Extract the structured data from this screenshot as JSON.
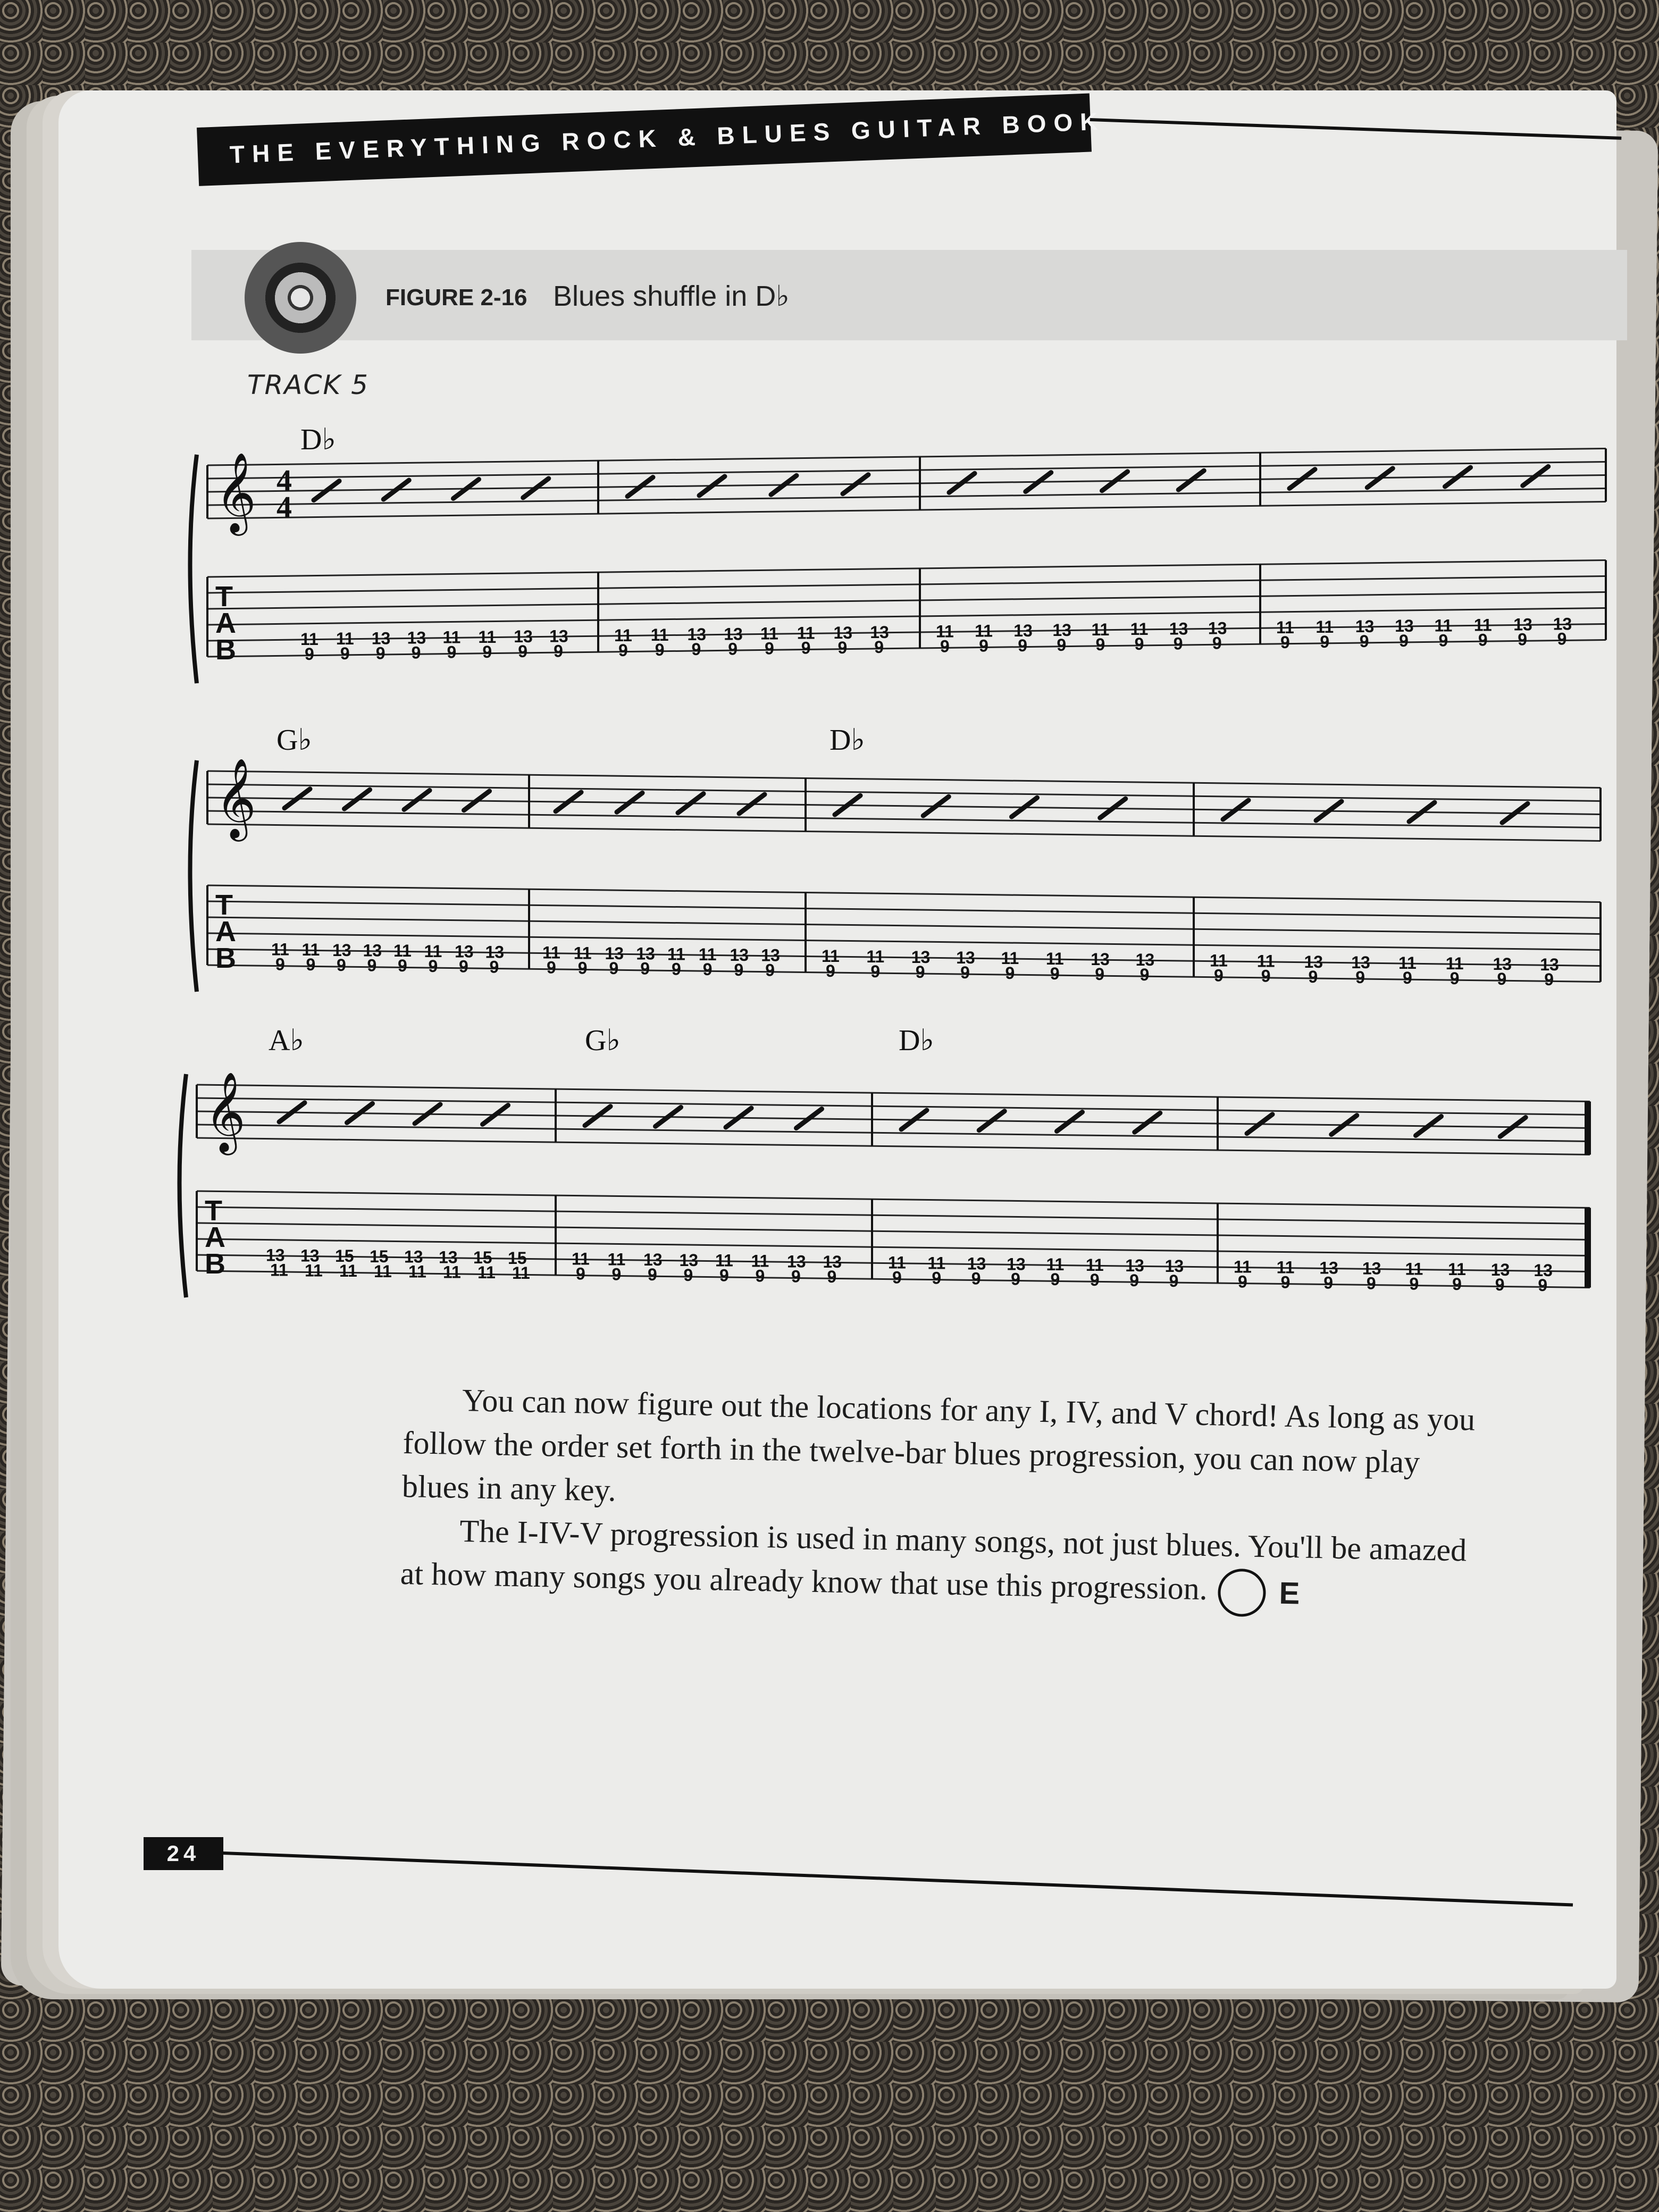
{
  "header": {
    "title": "THE EVERYTHING ROCK & BLUES GUITAR BOOK"
  },
  "figure": {
    "label": "FIGURE 2-16",
    "caption": "Blues shuffle in D♭",
    "track": "TRACK 5",
    "icon": "cd-icon"
  },
  "score": {
    "time_signature": "4/4",
    "clef": "treble",
    "tab_letters": [
      "T",
      "A",
      "B"
    ],
    "systems": [
      {
        "chords": [
          "D♭",
          "",
          "",
          ""
        ],
        "measures": [
          {
            "top": [
              "11",
              "11",
              "13",
              "13",
              "11",
              "11",
              "13",
              "13"
            ],
            "bottom": [
              "9",
              "9",
              "9",
              "9",
              "9",
              "9",
              "9",
              "9"
            ]
          },
          {
            "top": [
              "11",
              "11",
              "13",
              "13",
              "11",
              "11",
              "13",
              "13"
            ],
            "bottom": [
              "9",
              "9",
              "9",
              "9",
              "9",
              "9",
              "9",
              "9"
            ]
          },
          {
            "top": [
              "11",
              "11",
              "13",
              "13",
              "11",
              "11",
              "13",
              "13"
            ],
            "bottom": [
              "9",
              "9",
              "9",
              "9",
              "9",
              "9",
              "9",
              "9"
            ]
          },
          {
            "top": [
              "11",
              "11",
              "13",
              "13",
              "11",
              "11",
              "13",
              "13"
            ],
            "bottom": [
              "9",
              "9",
              "9",
              "9",
              "9",
              "9",
              "9",
              "9"
            ]
          }
        ]
      },
      {
        "chords": [
          "G♭",
          "",
          "D♭",
          ""
        ],
        "measures": [
          {
            "top": [
              "11",
              "11",
              "13",
              "13",
              "11",
              "11",
              "13",
              "13"
            ],
            "bottom": [
              "9",
              "9",
              "9",
              "9",
              "9",
              "9",
              "9",
              "9"
            ]
          },
          {
            "top": [
              "11",
              "11",
              "13",
              "13",
              "11",
              "11",
              "13",
              "13"
            ],
            "bottom": [
              "9",
              "9",
              "9",
              "9",
              "9",
              "9",
              "9",
              "9"
            ]
          },
          {
            "top": [
              "11",
              "11",
              "13",
              "13",
              "11",
              "11",
              "13",
              "13"
            ],
            "bottom": [
              "9",
              "9",
              "9",
              "9",
              "9",
              "9",
              "9",
              "9"
            ]
          },
          {
            "top": [
              "11",
              "11",
              "13",
              "13",
              "11",
              "11",
              "13",
              "13"
            ],
            "bottom": [
              "9",
              "9",
              "9",
              "9",
              "9",
              "9",
              "9",
              "9"
            ]
          }
        ]
      },
      {
        "chords": [
          "A♭",
          "G♭",
          "D♭",
          ""
        ],
        "measures": [
          {
            "top": [
              "13",
              "13",
              "15",
              "15",
              "13",
              "13",
              "15",
              "15"
            ],
            "bottom": [
              "11",
              "11",
              "11",
              "11",
              "11",
              "11",
              "11",
              "11"
            ]
          },
          {
            "top": [
              "11",
              "11",
              "13",
              "13",
              "11",
              "11",
              "13",
              "13"
            ],
            "bottom": [
              "9",
              "9",
              "9",
              "9",
              "9",
              "9",
              "9",
              "9"
            ]
          },
          {
            "top": [
              "11",
              "11",
              "13",
              "13",
              "11",
              "11",
              "13",
              "13"
            ],
            "bottom": [
              "9",
              "9",
              "9",
              "9",
              "9",
              "9",
              "9",
              "9"
            ]
          },
          {
            "top": [
              "11",
              "11",
              "13",
              "13",
              "11",
              "11",
              "13",
              "13"
            ],
            "bottom": [
              "9",
              "9",
              "9",
              "9",
              "9",
              "9",
              "9",
              "9"
            ]
          }
        ]
      }
    ]
  },
  "body": {
    "paragraph1": "You can now figure out the locations for any I, IV, and V chord! As long as you follow the order set forth in the twelve-bar blues progression, you can now play blues in any key.",
    "paragraph2": "The I-IV-V progression is used in many songs, not just blues. You'll be amazed at how many songs you already know that use this progression.",
    "end_marker": "E"
  },
  "footer": {
    "page_number": "24"
  }
}
